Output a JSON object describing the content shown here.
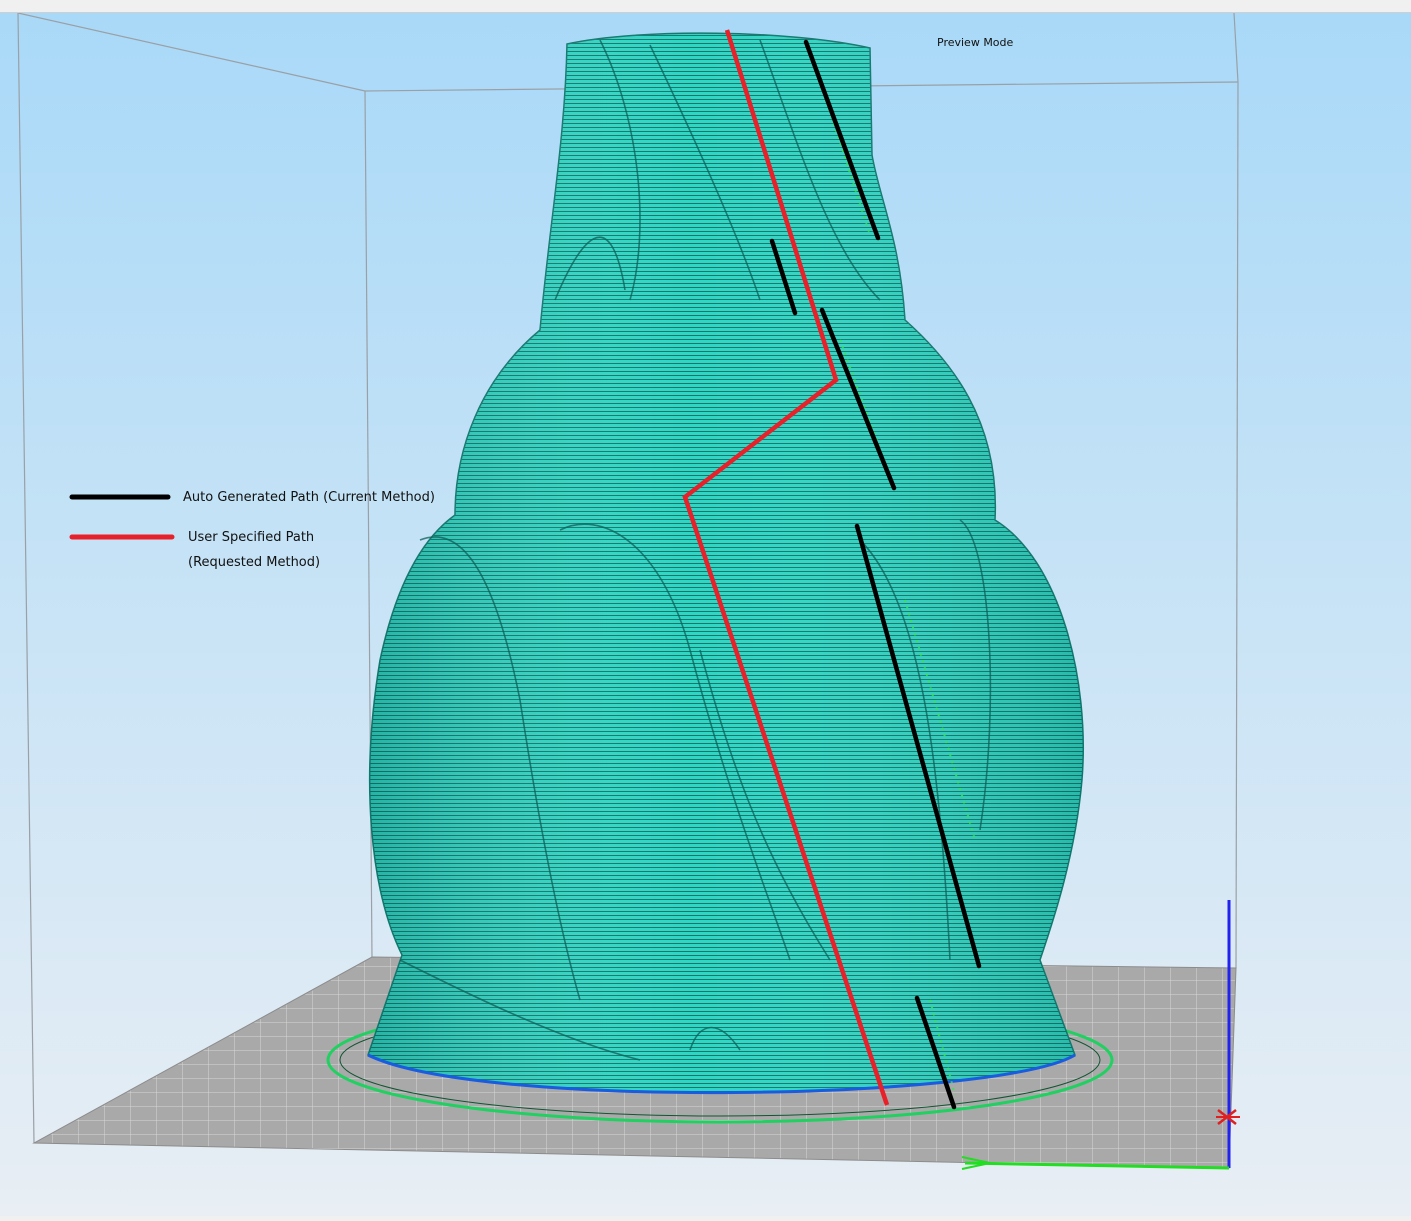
{
  "viewport": {
    "mode_label": "Preview Mode",
    "background_top": "#a9d9f8",
    "background_bottom": "#e8eef4",
    "bed_color": "#a7a7a7",
    "model_color": "#2ed6c4"
  },
  "legend": {
    "items": [
      {
        "line_color": "#000000",
        "lines": [
          "Auto Generated Path  (Current Method)"
        ]
      },
      {
        "line_color": "#e8202a",
        "lines": [
          "User Specified Path",
          "(Requested Method)"
        ]
      }
    ]
  },
  "axes": {
    "x_color": "#22dd22",
    "y_color": "#e02020",
    "z_color": "#2222ee"
  }
}
